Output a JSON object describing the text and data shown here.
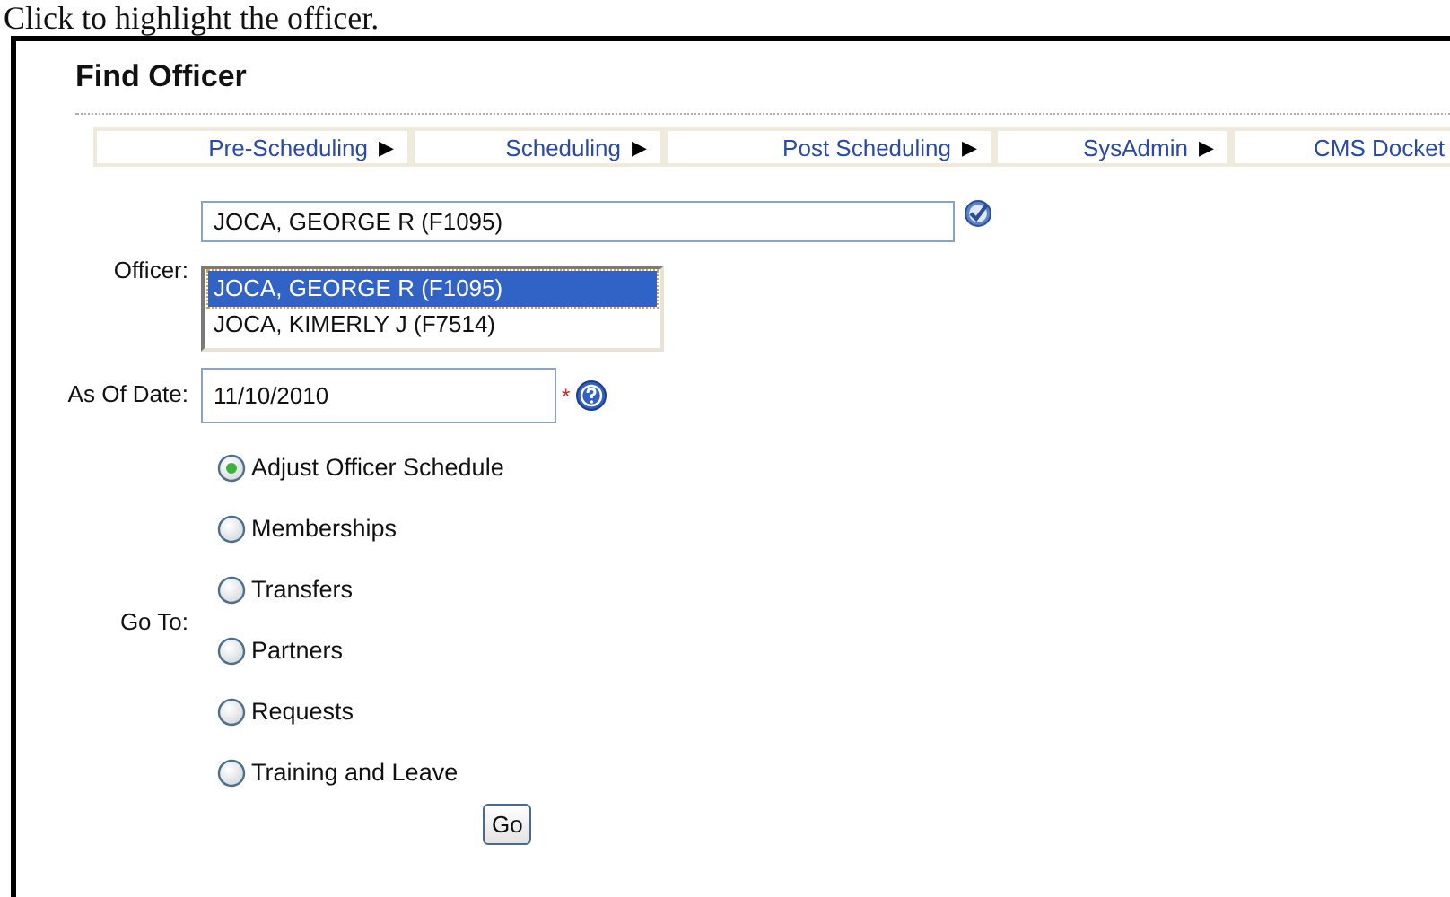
{
  "caption": "Click to highlight the officer.",
  "title": "Find Officer",
  "nav": [
    {
      "label": "Pre-Scheduling",
      "arrow": "▶"
    },
    {
      "label": "Scheduling",
      "arrow": "▶"
    },
    {
      "label": "Post Scheduling",
      "arrow": "▶"
    },
    {
      "label": "SysAdmin",
      "arrow": "▶"
    },
    {
      "label": "CMS Docket"
    }
  ],
  "officer": {
    "label": "Officer:",
    "value": "JOCA, GEORGE R (F1095)",
    "options": [
      {
        "label": "JOCA, GEORGE R (F1095)",
        "selected": true
      },
      {
        "label": "JOCA, KIMERLY J (F7514)",
        "selected": false
      }
    ]
  },
  "as_of_date": {
    "label": "As Of Date:",
    "value": "11/10/2010",
    "required_mark": "*"
  },
  "go_to": {
    "label": "Go To:",
    "options": [
      {
        "label": "Adjust Officer Schedule",
        "selected": true
      },
      {
        "label": "Memberships",
        "selected": false
      },
      {
        "label": "Transfers",
        "selected": false
      },
      {
        "label": "Partners",
        "selected": false
      },
      {
        "label": "Requests",
        "selected": false
      },
      {
        "label": "Training and Leave",
        "selected": false
      }
    ]
  },
  "go_button": "Go"
}
